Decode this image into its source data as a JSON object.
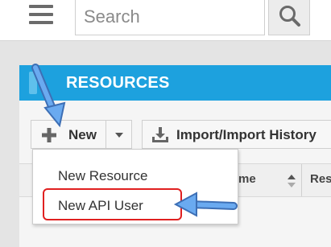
{
  "search": {
    "placeholder": "Search"
  },
  "panel": {
    "title": "RESOURCES"
  },
  "toolbar": {
    "new_label": "New",
    "import_label": "Import/Import History"
  },
  "table": {
    "columns": [
      "me",
      "Res"
    ]
  },
  "new_menu": {
    "items": [
      "New Resource",
      "New API User"
    ],
    "highlighted": "New API User"
  },
  "colors": {
    "header": "#1da1de",
    "highlight": "#e02020",
    "arrow": "#5a9de8"
  },
  "icons": [
    "menu-icon",
    "search-icon",
    "plus-icon",
    "caret-down-icon",
    "import-icon",
    "sort-icon"
  ]
}
